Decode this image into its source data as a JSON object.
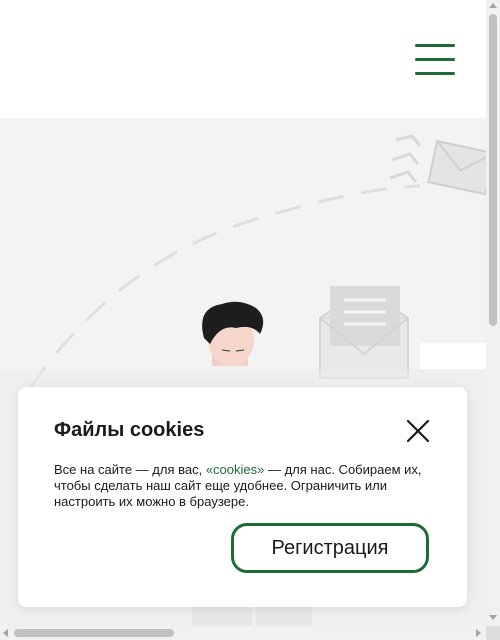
{
  "header": {
    "menu_icon": "hamburger-menu-icon",
    "accent_color": "#1e6b35"
  },
  "hero": {
    "illustration": "person-with-mail-envelopes-illustration"
  },
  "cookie_banner": {
    "title": "Файлы cookies",
    "text_before": "Все на сайте — для вас, ",
    "link_text": "«cookies»",
    "text_after": " — для нас. Собираем их, чтобы сделать наш сайт еще удобнее. Ограничить или настроить их можно в браузере.",
    "close_icon": "close-icon",
    "register_label": "Регистрация"
  }
}
